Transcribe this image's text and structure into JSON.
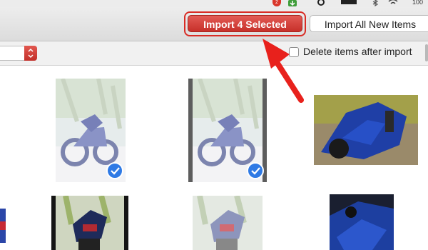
{
  "menubar": {
    "icons": [
      "notification-badge-icon",
      "download-icon",
      "sync-icon",
      "flag-icon",
      "bluetooth-icon",
      "wifi-icon"
    ],
    "badge": "2",
    "battery_text": "100"
  },
  "toolbar": {
    "import_selected_label": "Import 4 Selected",
    "import_all_label": "Import All New Items"
  },
  "options": {
    "delete_after_import_label": "Delete items after import",
    "delete_after_import_checked": false
  },
  "thumbnails": [
    {
      "name": "photo-1",
      "selected": true
    },
    {
      "name": "photo-2",
      "selected": true
    },
    {
      "name": "photo-3",
      "selected": false
    },
    {
      "name": "photo-4",
      "selected": false
    },
    {
      "name": "photo-5",
      "selected": false
    },
    {
      "name": "photo-6",
      "selected": false
    },
    {
      "name": "photo-7",
      "selected": false
    }
  ],
  "colors": {
    "accent_red": "#d92c25",
    "selection_blue": "#2f7ae5",
    "arrow_red": "#e8211c"
  }
}
